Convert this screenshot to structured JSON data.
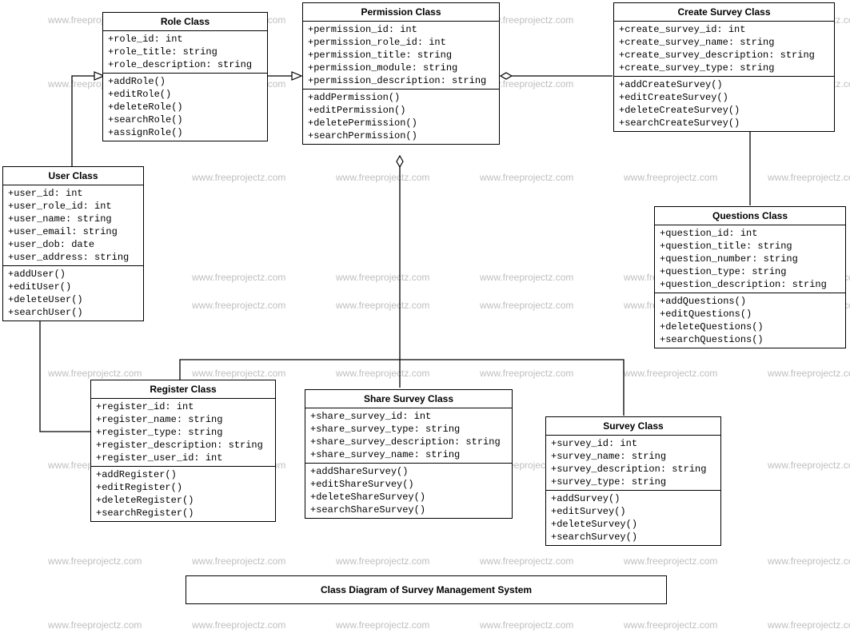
{
  "title": "Class Diagram of Survey Management System",
  "watermark_text": "www.freeprojectz.com",
  "classes": {
    "role": {
      "name": "Role Class",
      "attrs": [
        "+role_id: int",
        "+role_title: string",
        "+role_description: string"
      ],
      "ops": [
        "+addRole()",
        "+editRole()",
        "+deleteRole()",
        "+searchRole()",
        "+assignRole()"
      ]
    },
    "permission": {
      "name": "Permission Class",
      "attrs": [
        "+permission_id: int",
        "+permission_role_id: int",
        "+permission_title: string",
        "+permission_module: string",
        "+permission_description: string"
      ],
      "ops": [
        "+addPermission()",
        "+editPermission()",
        "+deletePermission()",
        "+searchPermission()"
      ]
    },
    "create_survey": {
      "name": "Create Survey Class",
      "attrs": [
        "+create_survey_id: int",
        "+create_survey_name: string",
        "+create_survey_description: string",
        "+create_survey_type: string"
      ],
      "ops": [
        "+addCreateSurvey()",
        "+editCreateSurvey()",
        "+deleteCreateSurvey()",
        "+searchCreateSurvey()"
      ]
    },
    "user": {
      "name": "User Class",
      "attrs": [
        "+user_id: int",
        "+user_role_id: int",
        "+user_name: string",
        "+user_email: string",
        "+user_dob: date",
        "+user_address: string"
      ],
      "ops": [
        "+addUser()",
        "+editUser()",
        "+deleteUser()",
        "+searchUser()"
      ]
    },
    "questions": {
      "name": "Questions Class",
      "attrs": [
        "+question_id: int",
        "+question_title: string",
        "+question_number: string",
        "+question_type: string",
        "+question_description: string"
      ],
      "ops": [
        "+addQuestions()",
        "+editQuestions()",
        "+deleteQuestions()",
        "+searchQuestions()"
      ]
    },
    "register": {
      "name": "Register Class",
      "attrs": [
        "+register_id: int",
        "+register_name: string",
        "+register_type: string",
        "+register_description: string",
        "+register_user_id: int"
      ],
      "ops": [
        "+addRegister()",
        "+editRegister()",
        "+deleteRegister()",
        "+searchRegister()"
      ]
    },
    "share_survey": {
      "name": "Share Survey Class",
      "attrs": [
        "+share_survey_id: int",
        "+share_survey_type: string",
        "+share_survey_description: string",
        "+share_survey_name: string"
      ],
      "ops": [
        "+addShareSurvey()",
        "+editShareSurvey()",
        "+deleteShareSurvey()",
        "+searchShareSurvey()"
      ]
    },
    "survey": {
      "name": "Survey Class",
      "attrs": [
        "+survey_id: int",
        "+survey_name: string",
        "+survey_description: string",
        "+survey_type: string"
      ],
      "ops": [
        "+addSurvey()",
        "+editSurvey()",
        "+deleteSurvey()",
        "+searchSurvey()"
      ]
    }
  }
}
